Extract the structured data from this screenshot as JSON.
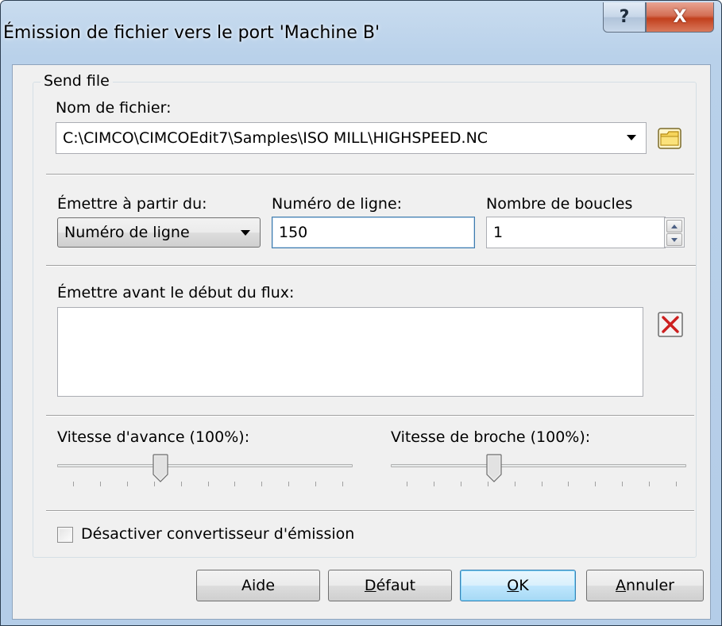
{
  "window": {
    "title": "Émission de fichier vers le port 'Machine B'",
    "help_glyph": "?",
    "close_glyph": "X"
  },
  "group": {
    "label": "Send file"
  },
  "file": {
    "label": "Nom de fichier:",
    "value": "C:\\CIMCO\\CIMCOEdit7\\Samples\\ISO MILL\\HIGHSPEED.NC",
    "browse_icon": "folder-icon"
  },
  "start": {
    "from_label": "Émettre à partir du:",
    "from_value": "Numéro de ligne",
    "line_label": "Numéro de ligne:",
    "line_value": "150",
    "loops_label": "Nombre de boucles",
    "loops_value": "1"
  },
  "pre_stream": {
    "label": "Émettre avant le début du flux:",
    "value": "",
    "clear_icon": "red-x-icon"
  },
  "sliders": {
    "feed_label": "Vitesse d'avance (100%):",
    "feed_level_percent": 100,
    "spindle_label": "Vitesse de broche (100%):",
    "spindle_level_percent": 100
  },
  "options": {
    "disable_converter_label": "Désactiver convertisseur d'émission",
    "disable_converter_checked": false
  },
  "buttons": {
    "help_label": "Aide",
    "default_label_underlined": "D",
    "default_label_rest": "éfaut",
    "ok_label_underlined": "O",
    "ok_label_rest": "K",
    "cancel_label_underlined": "A",
    "cancel_label_rest": "nnuler"
  },
  "colors": {
    "title_bar": "#b9d1ea",
    "close_button": "#c2401d",
    "dialog_bg": "#f0f0f0",
    "default_button": "#bee6fd"
  }
}
